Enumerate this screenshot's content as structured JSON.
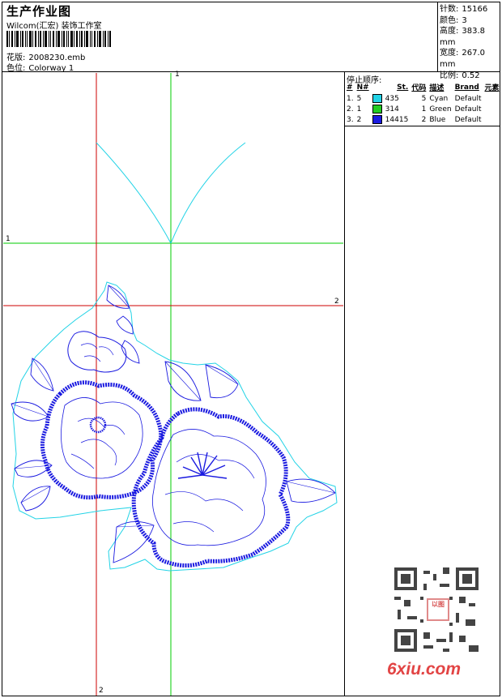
{
  "header": {
    "title": "生产作业图",
    "company": "Wilcom(汇宏) 装饰工作室",
    "pattern_label": "花版:",
    "pattern_value": "2008230.emb",
    "colorway_label": "色位:",
    "colorway_value": "Colorway 1"
  },
  "stats": {
    "stitches_label": "针数:",
    "stitches_value": "15166",
    "colors_label": "颜色:",
    "colors_value": "3",
    "height_label": "高度:",
    "height_value": "383.8 mm",
    "width_label": "宽度:",
    "width_value": "267.0 mm",
    "scale_label": "比例:",
    "scale_value": "0.52"
  },
  "color_order": {
    "title": "停止顺序:",
    "columns": [
      "#",
      "N#",
      "St.",
      "代码",
      "描述",
      "Brand",
      "元素"
    ],
    "rows": [
      {
        "idx": "1.",
        "n": "5",
        "st": "435",
        "code": "5",
        "desc": "Cyan",
        "brand": "Default",
        "color": "#22d3e6"
      },
      {
        "idx": "2.",
        "n": "1",
        "st": "314",
        "code": "1",
        "desc": "Green",
        "brand": "Default",
        "color": "#22cc22"
      },
      {
        "idx": "3.",
        "n": "2",
        "st": "14415",
        "code": "2",
        "desc": "Blue",
        "brand": "Default",
        "color": "#1a1ae0"
      }
    ]
  },
  "guides": {
    "green_top_label": "1",
    "green_left_label": "1",
    "red_right_label": "2",
    "red_bottom_label": "2"
  },
  "colors": {
    "guide_red": "#cc0000",
    "guide_green": "#00cc00",
    "cyan": "#22d3e6",
    "blue": "#1a1ae0"
  },
  "watermark": {
    "text": "6xiu.com",
    "seal_text": "以图"
  }
}
